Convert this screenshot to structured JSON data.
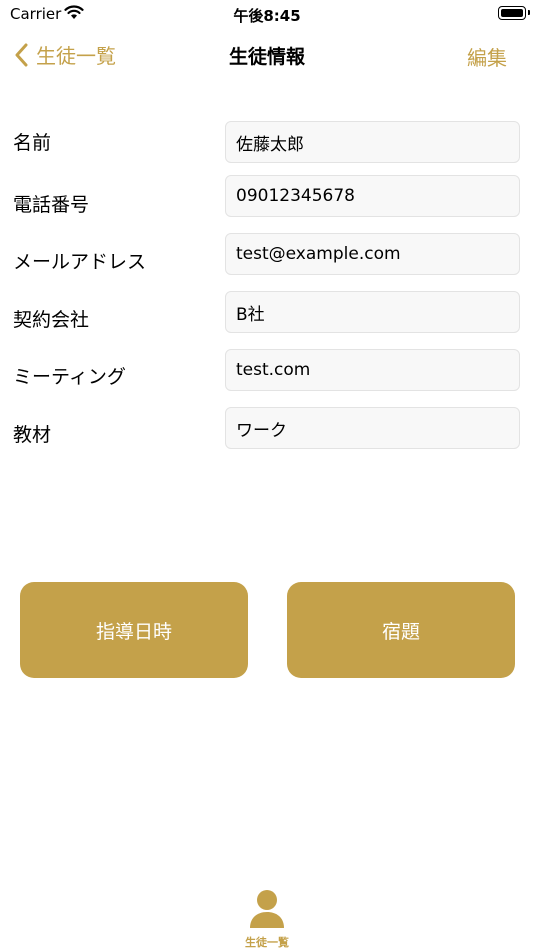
{
  "status_bar": {
    "carrier": "Carrier",
    "time": "午後8:45"
  },
  "nav": {
    "back_label": "生徒一覧",
    "title": "生徒情報",
    "edit_label": "編集"
  },
  "fields": [
    {
      "label": "名前",
      "value": "佐藤太郎"
    },
    {
      "label": "電話番号",
      "value": "09012345678"
    },
    {
      "label": "メールアドレス",
      "value": "test@example.com"
    },
    {
      "label": "契約会社",
      "value": "B社"
    },
    {
      "label": "ミーティング",
      "value": "test.com"
    },
    {
      "label": "教材",
      "value": "ワーク"
    }
  ],
  "buttons": {
    "schedule_label": "指導日時",
    "homework_label": "宿題"
  },
  "tab_bar": {
    "items": [
      {
        "label": "生徒一覧",
        "icon": "person-icon"
      }
    ]
  },
  "colors": {
    "accent": "#c4a14a"
  }
}
